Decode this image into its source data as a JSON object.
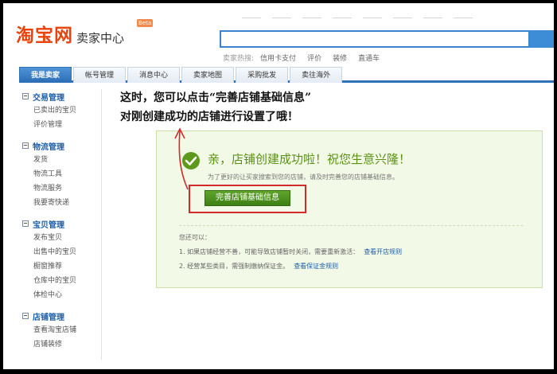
{
  "header": {
    "logo_main": "淘宝网",
    "logo_sub": "卖家中心",
    "logo_badge": "Beta",
    "hot_label": "卖家热搜:",
    "hot_links": [
      "信用卡支付",
      "评价",
      "装修",
      "直通车"
    ]
  },
  "nav": {
    "tabs": [
      "我是卖家",
      "帐号管理",
      "消息中心",
      "卖家地图",
      "采购批发",
      "卖往海外"
    ]
  },
  "sidebar": {
    "groups": [
      {
        "title": "交易管理",
        "items": [
          "已卖出的宝贝",
          "评价管理"
        ]
      },
      {
        "title": "物流管理",
        "items": [
          "发货",
          "物流工具",
          "物流服务",
          "我要寄快递"
        ]
      },
      {
        "title": "宝贝管理",
        "items": [
          "发布宝贝",
          "出售中的宝贝",
          "橱窗推荐",
          "仓库中的宝贝",
          "体检中心"
        ]
      },
      {
        "title": "店铺管理",
        "items": [
          "查看淘宝店铺",
          "店铺装修"
        ]
      }
    ]
  },
  "annotation": {
    "line1": "这时，您可以点击“完善店铺基础信息”",
    "line2": "对刚创建成功的店铺进行设置了哦！"
  },
  "panel": {
    "title": "亲，店铺创建成功啦！祝您生意兴隆！",
    "description": "为了更好的让买家搜索到您的店铺，请及时完善您的店铺基础信息。",
    "button_label": "完善店铺基础信息",
    "also_label": "您还可以：",
    "tips": [
      {
        "text": "1. 如果店铺经营不善，可能导致店铺暂时关闭，需要重新激活：",
        "link": "查看开店规则"
      },
      {
        "text": "2. 经营某些类目，需强制缴纳保证金。",
        "link": "查看保证金规则"
      }
    ]
  },
  "colors": {
    "brand": "#e8430c",
    "nav_blue": "#2f73b8",
    "success_green": "#5d9a1b",
    "highlight_red": "#d32a2a"
  }
}
